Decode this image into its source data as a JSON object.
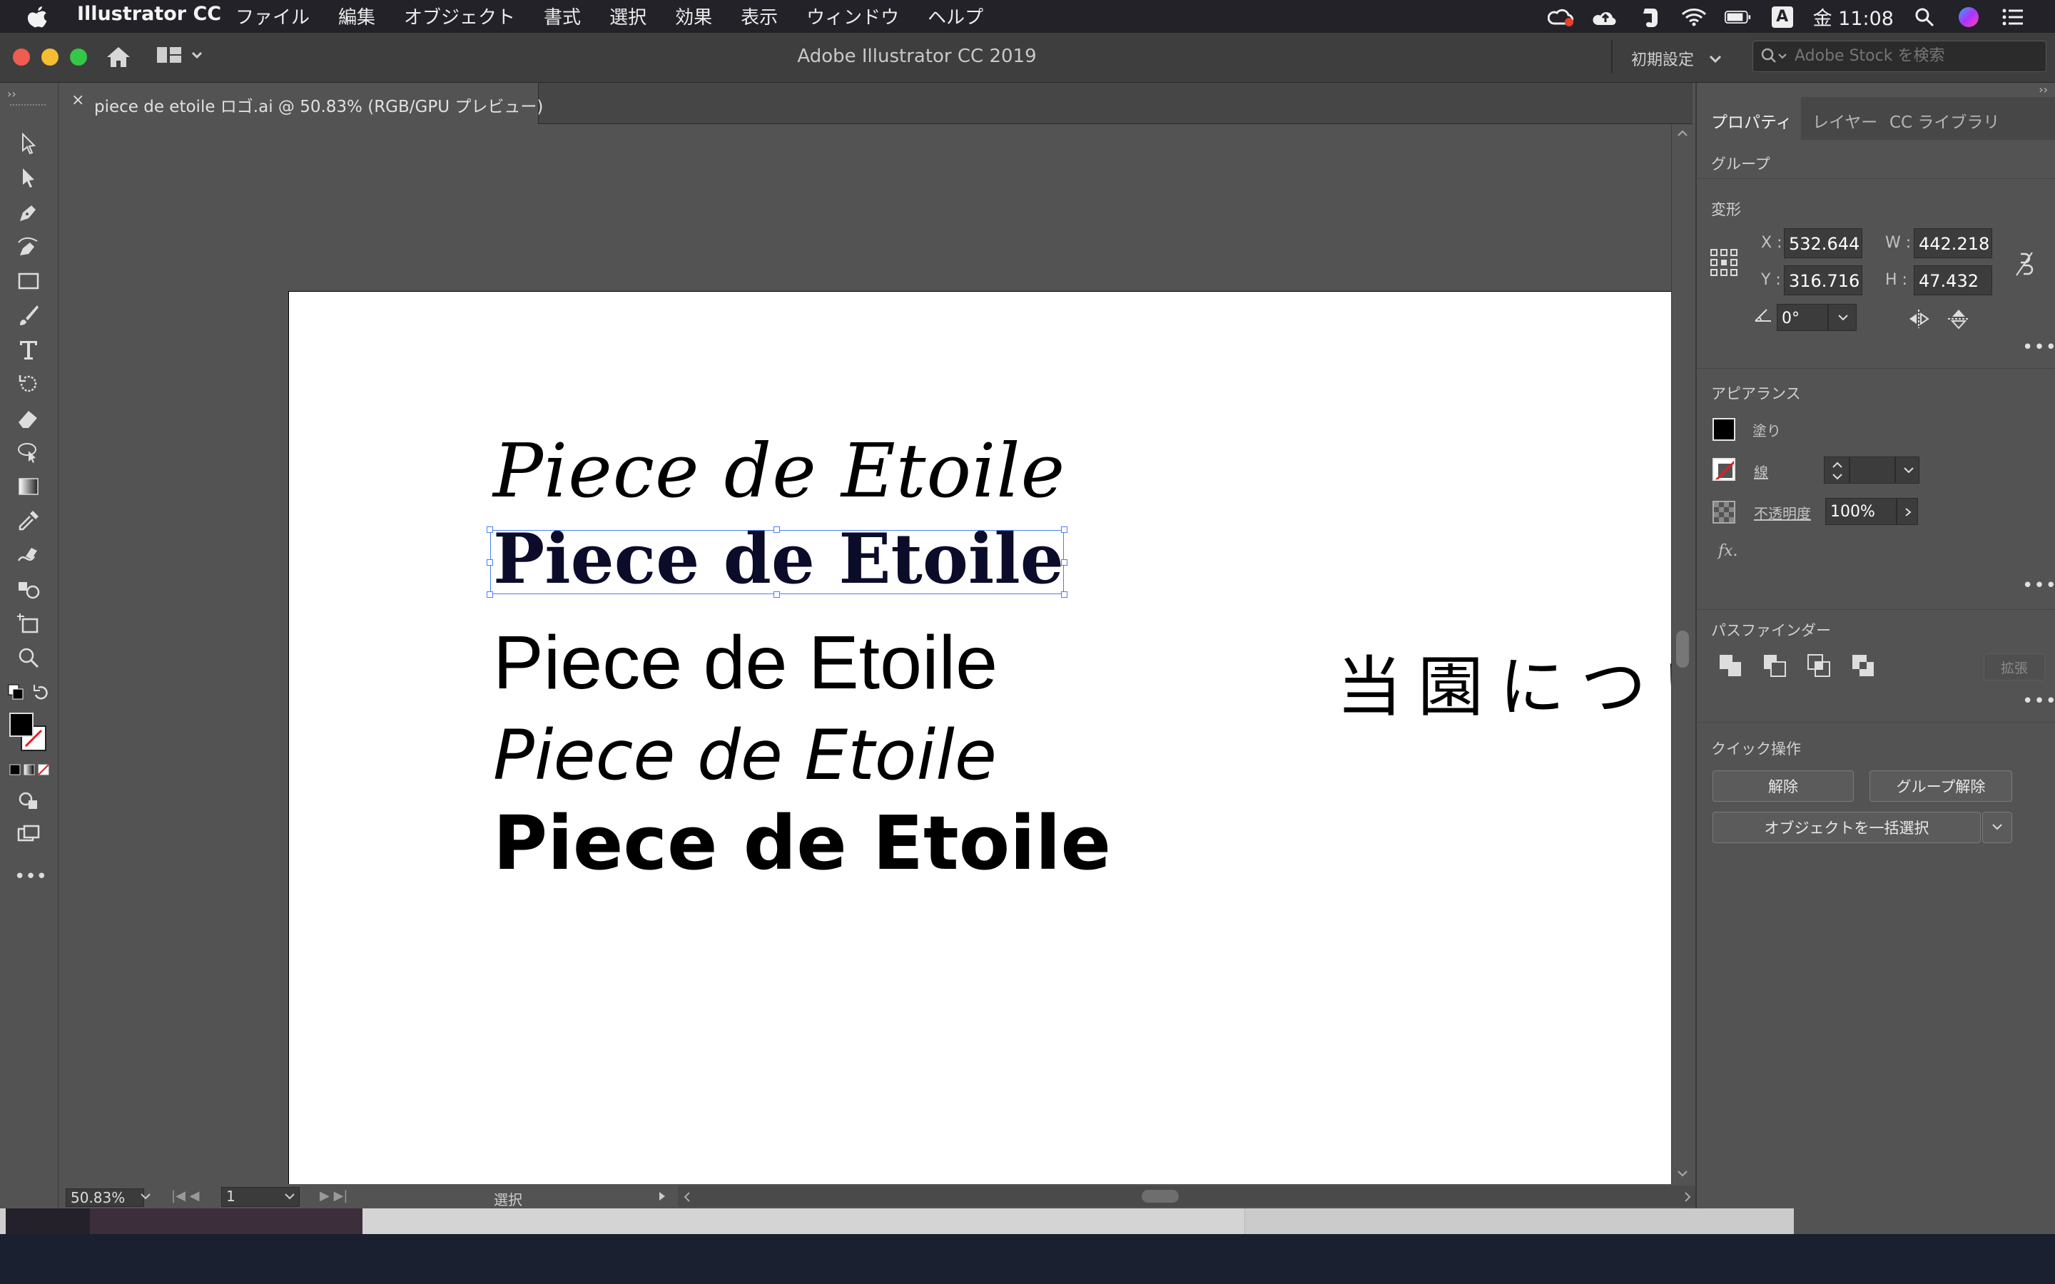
{
  "menubar": {
    "app_name": "Illustrator CC",
    "items": [
      "ファイル",
      "編集",
      "オブジェクト",
      "書式",
      "選択",
      "効果",
      "表示",
      "ウィンドウ",
      "ヘルプ"
    ],
    "input_source": "A",
    "clock": "金 11:08"
  },
  "window": {
    "title": "Adobe Illustrator CC 2019",
    "workspace": "初期設定",
    "stock_search_placeholder": "Adobe Stock を検索"
  },
  "document_tab": {
    "close": "×",
    "label": "piece de etoile ロゴ.ai @ 50.83% (RGB/GPU プレビュー)"
  },
  "artboard": {
    "lines": [
      "Piece de Etoile",
      "Piece de Etoile",
      "Piece de Etoile",
      "Piece de Etoile",
      "Piece de Etoile"
    ],
    "japanese": "当園につい"
  },
  "statusbar": {
    "zoom": "50.83%",
    "artboard_number": "1",
    "tool_name": "選択"
  },
  "panel": {
    "tabs": [
      "プロパティ",
      "レイヤー",
      "CC ライブラリ"
    ],
    "selection_type": "グループ",
    "transform": {
      "title": "変形",
      "x_label": "X :",
      "x_value": "532.644",
      "y_label": "Y :",
      "y_value": "316.716",
      "w_label": "W :",
      "w_value": "442.218",
      "h_label": "H :",
      "h_value": "47.432",
      "angle_value": "0°"
    },
    "appearance": {
      "title": "アピアランス",
      "fill_label": "塗り",
      "stroke_label": "線",
      "opacity_label": "不透明度",
      "opacity_value": "100%",
      "fx_label": "fx."
    },
    "pathfinder": {
      "title": "パスファインダー",
      "expand_label": "拡張"
    },
    "quick_actions": {
      "title": "クイック操作",
      "release_label": "解除",
      "ungroup_label": "グループ解除",
      "select_same_label": "オブジェクトを一括選択"
    }
  }
}
